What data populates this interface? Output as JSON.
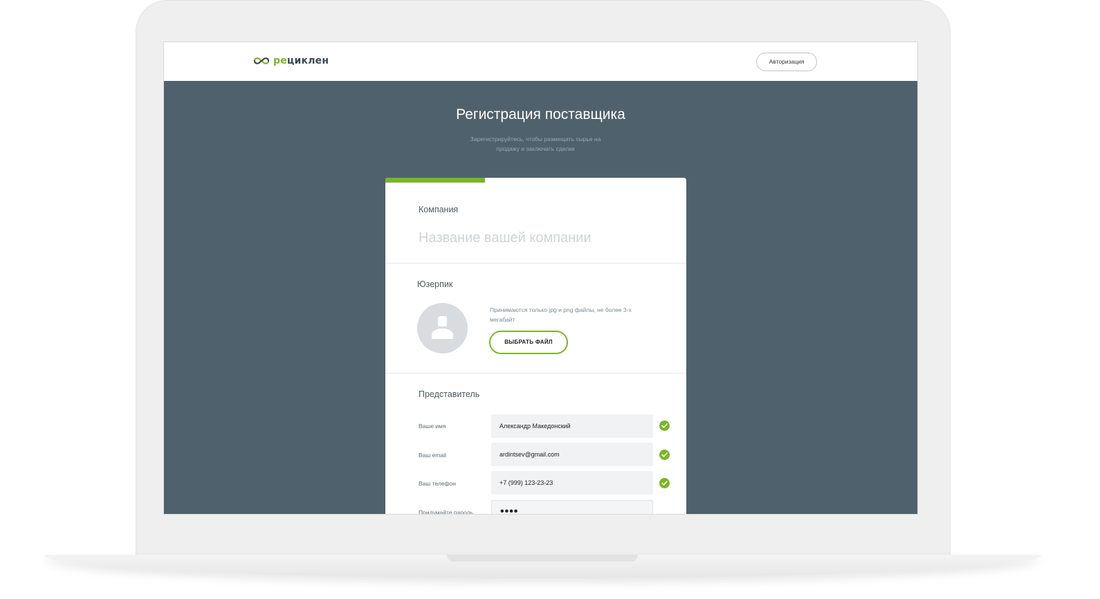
{
  "header": {
    "logo_text_accent": "ре",
    "logo_text_main": "циклен",
    "login_button": "Авторизация"
  },
  "hero": {
    "title": "Регистрация поставщика",
    "subtitle": "Зарегистрируйтесь, чтобы размещать сырье на продажу и заключать сделки"
  },
  "form": {
    "progress_fraction": 0.33,
    "company": {
      "label": "Компания",
      "placeholder": "Название вашей компании",
      "value": ""
    },
    "userpic": {
      "label": "Юзерпик",
      "hint": "Принимаются только jpg и png файлы, не более 3-х мегабайт",
      "button": "ВЫБРАТЬ ФАЙЛ"
    },
    "representative": {
      "label": "Представитель",
      "fields": [
        {
          "label": "Ваше имя",
          "value": "Александр Македонский",
          "valid": true
        },
        {
          "label": "Ваш email",
          "value": "ardintsev@gmail.com",
          "valid": true
        },
        {
          "label": "Ваш телефон",
          "value": "+7 (999) 123-23-23",
          "valid": true
        },
        {
          "label": "Придумайте пароль",
          "value": "••••",
          "valid": false
        }
      ]
    }
  },
  "colors": {
    "accent": "#7ab527",
    "page_bg": "#4f616c",
    "logo_dark": "#3a4a55"
  }
}
